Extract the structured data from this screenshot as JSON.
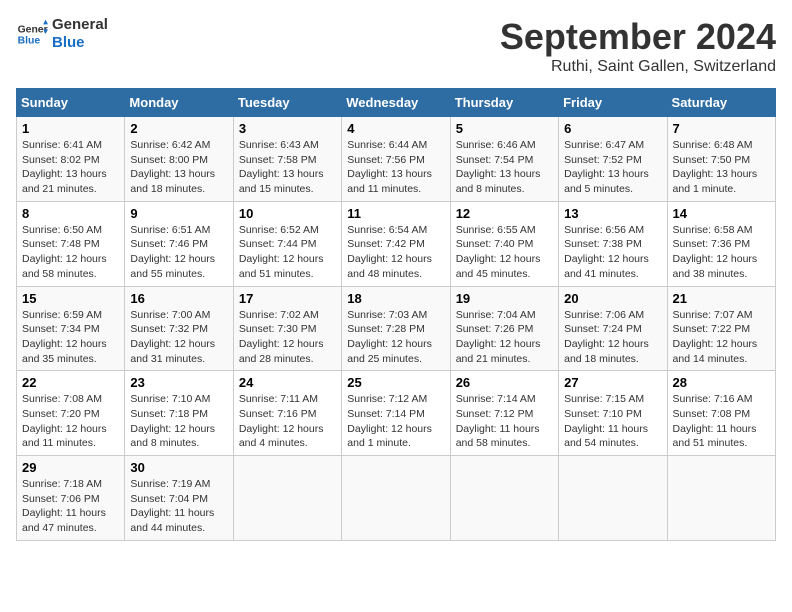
{
  "logo": {
    "line1": "General",
    "line2": "Blue"
  },
  "title": "September 2024",
  "subtitle": "Ruthi, Saint Gallen, Switzerland",
  "days_of_week": [
    "Sunday",
    "Monday",
    "Tuesday",
    "Wednesday",
    "Thursday",
    "Friday",
    "Saturday"
  ],
  "weeks": [
    [
      {
        "day": "1",
        "info": "Sunrise: 6:41 AM\nSunset: 8:02 PM\nDaylight: 13 hours\nand 21 minutes."
      },
      {
        "day": "2",
        "info": "Sunrise: 6:42 AM\nSunset: 8:00 PM\nDaylight: 13 hours\nand 18 minutes."
      },
      {
        "day": "3",
        "info": "Sunrise: 6:43 AM\nSunset: 7:58 PM\nDaylight: 13 hours\nand 15 minutes."
      },
      {
        "day": "4",
        "info": "Sunrise: 6:44 AM\nSunset: 7:56 PM\nDaylight: 13 hours\nand 11 minutes."
      },
      {
        "day": "5",
        "info": "Sunrise: 6:46 AM\nSunset: 7:54 PM\nDaylight: 13 hours\nand 8 minutes."
      },
      {
        "day": "6",
        "info": "Sunrise: 6:47 AM\nSunset: 7:52 PM\nDaylight: 13 hours\nand 5 minutes."
      },
      {
        "day": "7",
        "info": "Sunrise: 6:48 AM\nSunset: 7:50 PM\nDaylight: 13 hours\nand 1 minute."
      }
    ],
    [
      {
        "day": "8",
        "info": "Sunrise: 6:50 AM\nSunset: 7:48 PM\nDaylight: 12 hours\nand 58 minutes."
      },
      {
        "day": "9",
        "info": "Sunrise: 6:51 AM\nSunset: 7:46 PM\nDaylight: 12 hours\nand 55 minutes."
      },
      {
        "day": "10",
        "info": "Sunrise: 6:52 AM\nSunset: 7:44 PM\nDaylight: 12 hours\nand 51 minutes."
      },
      {
        "day": "11",
        "info": "Sunrise: 6:54 AM\nSunset: 7:42 PM\nDaylight: 12 hours\nand 48 minutes."
      },
      {
        "day": "12",
        "info": "Sunrise: 6:55 AM\nSunset: 7:40 PM\nDaylight: 12 hours\nand 45 minutes."
      },
      {
        "day": "13",
        "info": "Sunrise: 6:56 AM\nSunset: 7:38 PM\nDaylight: 12 hours\nand 41 minutes."
      },
      {
        "day": "14",
        "info": "Sunrise: 6:58 AM\nSunset: 7:36 PM\nDaylight: 12 hours\nand 38 minutes."
      }
    ],
    [
      {
        "day": "15",
        "info": "Sunrise: 6:59 AM\nSunset: 7:34 PM\nDaylight: 12 hours\nand 35 minutes."
      },
      {
        "day": "16",
        "info": "Sunrise: 7:00 AM\nSunset: 7:32 PM\nDaylight: 12 hours\nand 31 minutes."
      },
      {
        "day": "17",
        "info": "Sunrise: 7:02 AM\nSunset: 7:30 PM\nDaylight: 12 hours\nand 28 minutes."
      },
      {
        "day": "18",
        "info": "Sunrise: 7:03 AM\nSunset: 7:28 PM\nDaylight: 12 hours\nand 25 minutes."
      },
      {
        "day": "19",
        "info": "Sunrise: 7:04 AM\nSunset: 7:26 PM\nDaylight: 12 hours\nand 21 minutes."
      },
      {
        "day": "20",
        "info": "Sunrise: 7:06 AM\nSunset: 7:24 PM\nDaylight: 12 hours\nand 18 minutes."
      },
      {
        "day": "21",
        "info": "Sunrise: 7:07 AM\nSunset: 7:22 PM\nDaylight: 12 hours\nand 14 minutes."
      }
    ],
    [
      {
        "day": "22",
        "info": "Sunrise: 7:08 AM\nSunset: 7:20 PM\nDaylight: 12 hours\nand 11 minutes."
      },
      {
        "day": "23",
        "info": "Sunrise: 7:10 AM\nSunset: 7:18 PM\nDaylight: 12 hours\nand 8 minutes."
      },
      {
        "day": "24",
        "info": "Sunrise: 7:11 AM\nSunset: 7:16 PM\nDaylight: 12 hours\nand 4 minutes."
      },
      {
        "day": "25",
        "info": "Sunrise: 7:12 AM\nSunset: 7:14 PM\nDaylight: 12 hours\nand 1 minute."
      },
      {
        "day": "26",
        "info": "Sunrise: 7:14 AM\nSunset: 7:12 PM\nDaylight: 11 hours\nand 58 minutes."
      },
      {
        "day": "27",
        "info": "Sunrise: 7:15 AM\nSunset: 7:10 PM\nDaylight: 11 hours\nand 54 minutes."
      },
      {
        "day": "28",
        "info": "Sunrise: 7:16 AM\nSunset: 7:08 PM\nDaylight: 11 hours\nand 51 minutes."
      }
    ],
    [
      {
        "day": "29",
        "info": "Sunrise: 7:18 AM\nSunset: 7:06 PM\nDaylight: 11 hours\nand 47 minutes."
      },
      {
        "day": "30",
        "info": "Sunrise: 7:19 AM\nSunset: 7:04 PM\nDaylight: 11 hours\nand 44 minutes."
      },
      {
        "day": "",
        "info": ""
      },
      {
        "day": "",
        "info": ""
      },
      {
        "day": "",
        "info": ""
      },
      {
        "day": "",
        "info": ""
      },
      {
        "day": "",
        "info": ""
      }
    ]
  ]
}
